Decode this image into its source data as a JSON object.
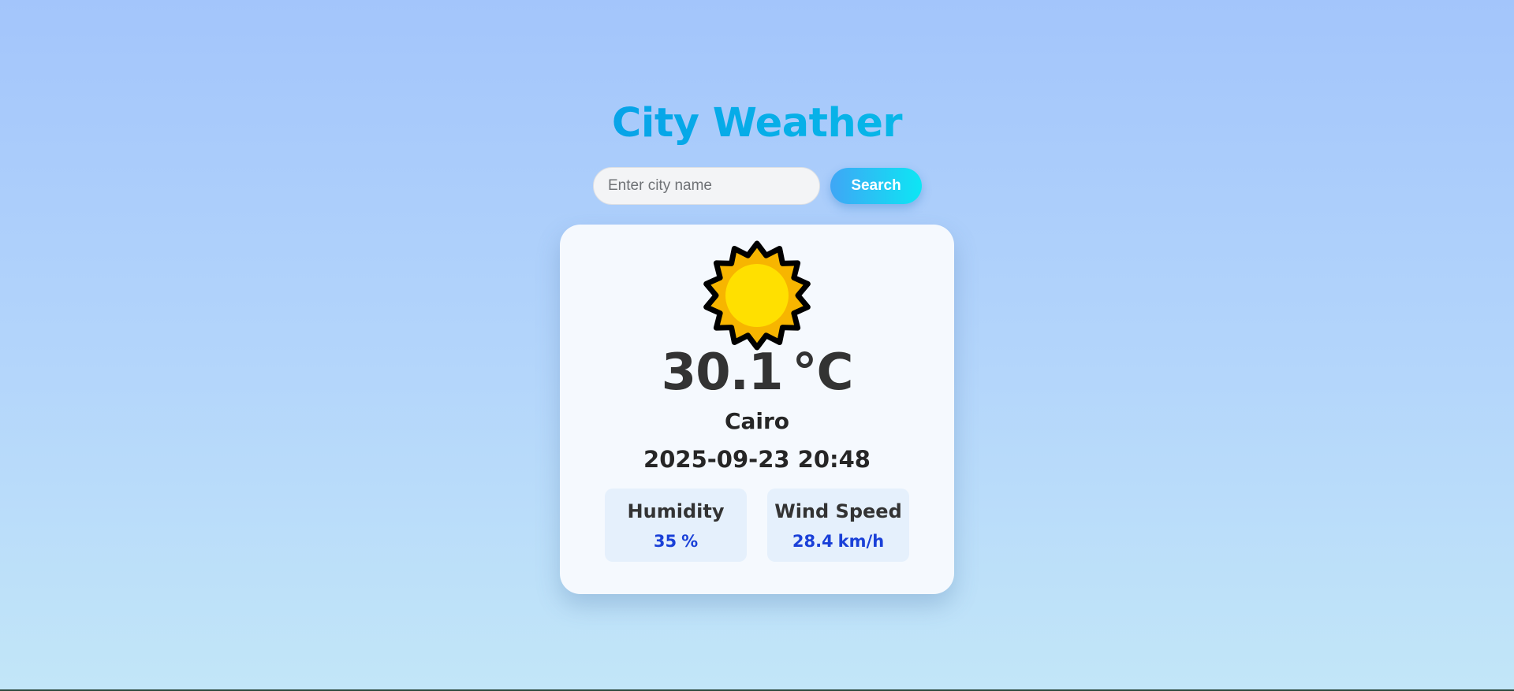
{
  "header": {
    "title_word1": "City",
    "title_word2": "Weather"
  },
  "search": {
    "placeholder": "Enter city name",
    "value": "",
    "button_label": "Search"
  },
  "weather": {
    "icon": "sun-icon",
    "temperature": "30.1",
    "temperature_unit": "°C",
    "city": "Cairo",
    "datetime": "2025-09-23 20:48"
  },
  "stats": {
    "humidity": {
      "label": "Humidity",
      "value": "35",
      "unit": "%"
    },
    "wind": {
      "label": "Wind Speed",
      "value": "28.4",
      "unit": "km/h"
    }
  },
  "colors": {
    "title_gradient_start": "#1478e8",
    "title_gradient_end": "#0ce0e6",
    "button_gradient_start": "#3fa6f5",
    "button_gradient_end": "#0de6f4",
    "stat_value": "#1a40d8",
    "sun_outer": "#f7b500",
    "sun_inner": "#ffe000"
  }
}
